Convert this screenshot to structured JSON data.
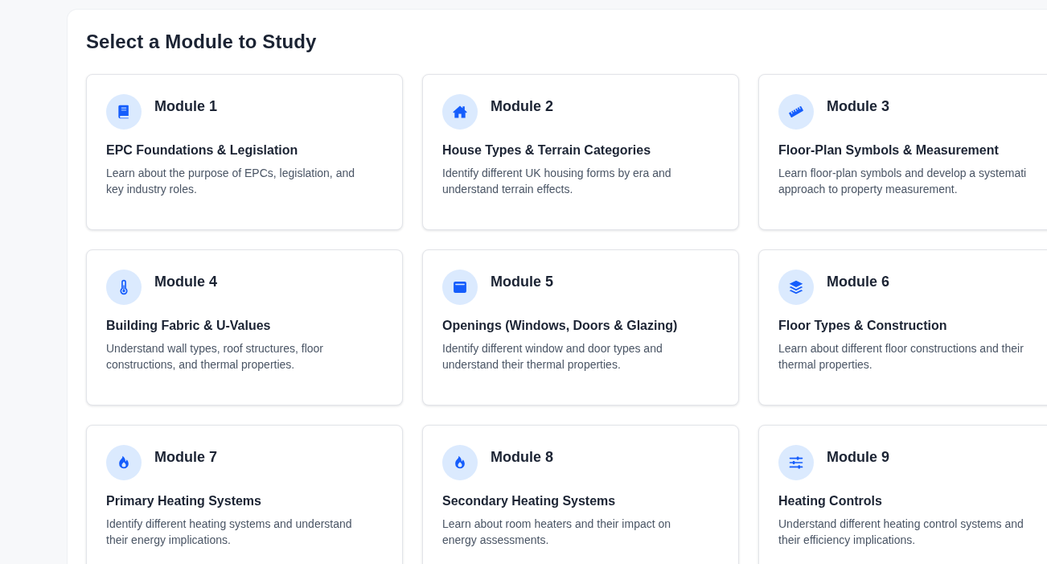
{
  "heading": "Select a Module to Study",
  "modules": [
    {
      "label": "Module 1",
      "title": "EPC Foundations & Legislation",
      "description": "Learn about the purpose of EPCs, legislation, and key industry roles."
    },
    {
      "label": "Module 2",
      "title": "House Types & Terrain Categories",
      "description": "Identify different UK housing forms by era and understand terrain effects."
    },
    {
      "label": "Module 3",
      "title": "Floor-Plan Symbols & Measurement",
      "description": "Learn floor-plan symbols and develop a systemati approach to property measurement."
    },
    {
      "label": "Module 4",
      "title": "Building Fabric & U-Values",
      "description": "Understand wall types, roof structures, floor constructions, and thermal properties."
    },
    {
      "label": "Module 5",
      "title": "Openings (Windows, Doors & Glazing)",
      "description": "Identify different window and door types and understand their thermal properties."
    },
    {
      "label": "Module 6",
      "title": "Floor Types & Construction",
      "description": "Learn about different floor constructions and their thermal properties."
    },
    {
      "label": "Module 7",
      "title": "Primary Heating Systems",
      "description": "Identify different heating systems and understand their energy implications."
    },
    {
      "label": "Module 8",
      "title": "Secondary Heating Systems",
      "description": "Learn about room heaters and their impact on energy assessments."
    },
    {
      "label": "Module 9",
      "title": "Heating Controls",
      "description": "Understand different heating control systems and their efficiency implications."
    }
  ]
}
